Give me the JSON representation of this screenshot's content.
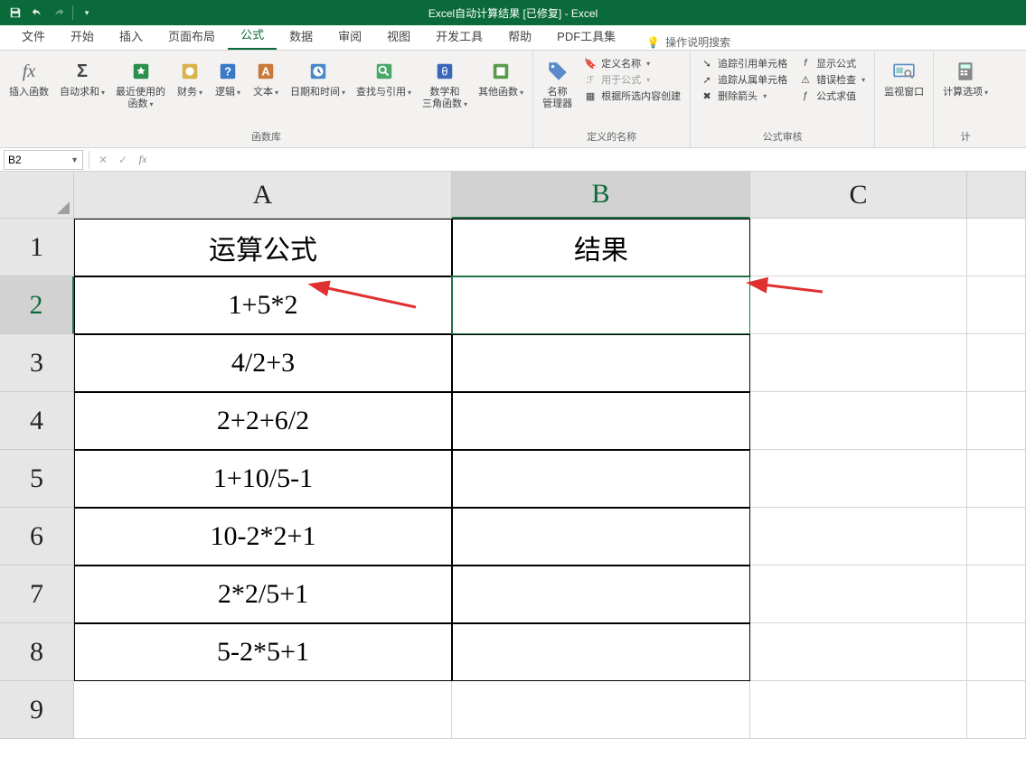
{
  "app": {
    "title": "Excel自动计算结果 [已修复]  -  Excel"
  },
  "tabs": [
    "文件",
    "开始",
    "插入",
    "页面布局",
    "公式",
    "数据",
    "审阅",
    "视图",
    "开发工具",
    "帮助",
    "PDF工具集"
  ],
  "active_tab_index": 4,
  "tell_me": "操作说明搜索",
  "ribbon": {
    "insert_function": "插入函数",
    "autosum": "自动求和",
    "recent": "最近使用的\n函数",
    "financial": "财务",
    "logical": "逻辑",
    "text": "文本",
    "date_time": "日期和时间",
    "lookup": "查找与引用",
    "math": "数学和\n三角函数",
    "more": "其他函数",
    "group_lib": "函数库",
    "name_mgr": "名称\n管理器",
    "define_name": "定义名称",
    "use_in_formula": "用于公式",
    "create_from_sel": "根据所选内容创建",
    "group_names": "定义的名称",
    "trace_prec": "追踪引用单元格",
    "trace_dep": "追踪从属单元格",
    "remove_arrows": "删除箭头",
    "show_formulas": "显示公式",
    "error_check": "错误检查",
    "eval_formula": "公式求值",
    "group_audit": "公式审核",
    "watch": "监视窗口",
    "calc_options": "计算选项",
    "group_calc": "计"
  },
  "name_box": "B2",
  "columns": [
    "A",
    "B",
    "C"
  ],
  "sheet": {
    "rows": [
      {
        "n": "1",
        "a": "运算公式",
        "b": "结果"
      },
      {
        "n": "2",
        "a": "1+5*2",
        "b": ""
      },
      {
        "n": "3",
        "a": "4/2+3",
        "b": ""
      },
      {
        "n": "4",
        "a": "2+2+6/2",
        "b": ""
      },
      {
        "n": "5",
        "a": "1+10/5-1",
        "b": ""
      },
      {
        "n": "6",
        "a": "10-2*2+1",
        "b": ""
      },
      {
        "n": "7",
        "a": "2*2/5+1",
        "b": ""
      },
      {
        "n": "8",
        "a": "5-2*5+1",
        "b": ""
      },
      {
        "n": "9",
        "a": "",
        "b": ""
      }
    ]
  },
  "selected_cell": "B2"
}
